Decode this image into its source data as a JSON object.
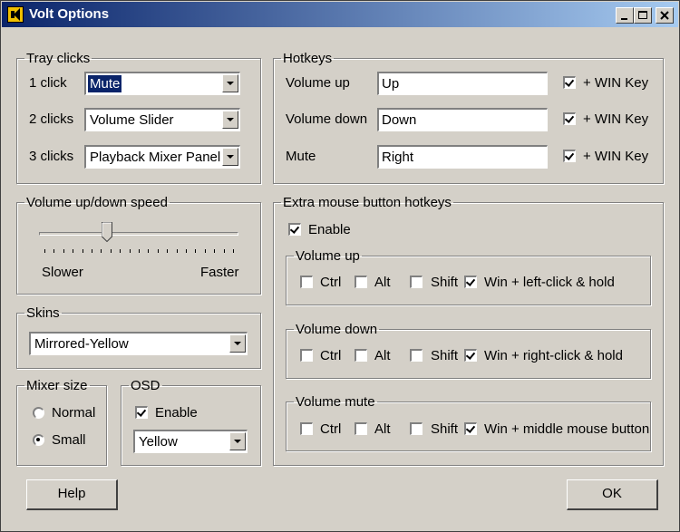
{
  "window": {
    "title": "Volt Options"
  },
  "tray": {
    "legend": "Tray clicks",
    "rows": [
      {
        "label": "1 click",
        "value": "Mute"
      },
      {
        "label": "2 clicks",
        "value": "Volume Slider"
      },
      {
        "label": "3 clicks",
        "value": "Playback Mixer Panel"
      }
    ]
  },
  "speed": {
    "legend": "Volume up/down speed",
    "slower": "Slower",
    "faster": "Faster",
    "level_fraction": 0.33
  },
  "skins": {
    "legend": "Skins",
    "value": "Mirrored-Yellow"
  },
  "mixer": {
    "legend": "Mixer size",
    "normal": "Normal",
    "small": "Small",
    "selected": "Small"
  },
  "osd": {
    "legend": "OSD",
    "enable": "Enable",
    "enabled": true,
    "color": "Yellow"
  },
  "hotkeys": {
    "legend": "Hotkeys",
    "rows": [
      {
        "label": "Volume up",
        "value": "Up",
        "win": "+ WIN Key",
        "checked": true
      },
      {
        "label": "Volume down",
        "value": "Down",
        "win": "+ WIN Key",
        "checked": true
      },
      {
        "label": "Mute",
        "value": "Right",
        "win": "+ WIN Key",
        "checked": true
      }
    ]
  },
  "extra": {
    "legend": "Extra mouse button hotkeys",
    "enable": "Enable",
    "enabled": true,
    "groups": [
      {
        "legend": "Volume up",
        "ctrl": "Ctrl",
        "alt": "Alt",
        "shift": "Shift",
        "win": "Win + left-click & hold"
      },
      {
        "legend": "Volume down",
        "ctrl": "Ctrl",
        "alt": "Alt",
        "shift": "Shift",
        "win": "Win + right-click & hold"
      },
      {
        "legend": "Volume mute",
        "ctrl": "Ctrl",
        "alt": "Alt",
        "shift": "Shift",
        "win": "Win + middle mouse button"
      }
    ]
  },
  "buttons": {
    "help": "Help",
    "ok": "OK"
  },
  "colors": {
    "titlebar_start": "#0a246a",
    "titlebar_end": "#a6caf0",
    "face": "#d4d0c8",
    "highlight": "#0a246a"
  }
}
